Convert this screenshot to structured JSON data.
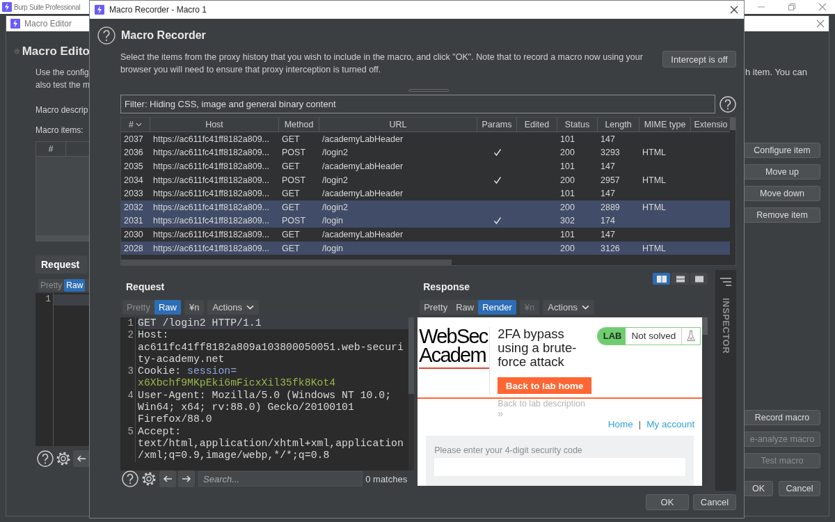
{
  "app_window": {
    "title": "Burp Suite Professional"
  },
  "macro_editor": {
    "title": "Macro Editor",
    "heading": "Macro Edito",
    "description_left": [
      "Use the config",
      "also test the m"
    ],
    "description_right": "h item. You can",
    "description_label": "Macro descrip",
    "items_label": "Macro items:",
    "items_columns": [
      "#"
    ],
    "request_tab": "Request",
    "view_tabs": [
      {
        "label": "Pretty",
        "selected": false
      },
      {
        "label": "Raw",
        "selected": true
      }
    ],
    "line_numbers": [
      "1"
    ],
    "side_buttons": [
      {
        "label": "Configure item",
        "disabled": false
      },
      {
        "label": "Move up",
        "disabled": false
      },
      {
        "label": "Move down",
        "disabled": false
      },
      {
        "label": "Remove item",
        "disabled": false
      }
    ],
    "macro_buttons": [
      {
        "label": "Record macro",
        "disabled": false
      },
      {
        "label": "e-analyze macro",
        "disabled": true
      },
      {
        "label": "Test macro",
        "disabled": true
      }
    ],
    "dialog_buttons": [
      "OK",
      "Cancel"
    ]
  },
  "macro_recorder": {
    "title": "Macro Recorder - Macro 1",
    "heading": "Macro Recorder",
    "description": "Select the items from the proxy history that you wish to include in the macro, and click \"OK\". Note that to record a macro now using your browser you will need to ensure that proxy interception is turned off.",
    "intercept_button": "Intercept is off",
    "filter": "Filter: Hiding CSS, image and general binary content",
    "table": {
      "columns": [
        "#",
        "Host",
        "Method",
        "URL",
        "Params",
        "Edited",
        "Status",
        "Length",
        "MIME type",
        "Extensio"
      ],
      "rows": [
        {
          "number": "2037",
          "host": "https://ac611fc41ff8182a809...",
          "method": "GET",
          "url": "/academyLabHeader",
          "params": false,
          "status": "101",
          "length": "147",
          "selected": false
        },
        {
          "number": "2036",
          "host": "https://ac611fc41ff8182a809...",
          "method": "POST",
          "url": "/login2",
          "params": true,
          "status": "200",
          "length": "3293",
          "mime": "HTML",
          "selected": false
        },
        {
          "number": "2035",
          "host": "https://ac611fc41ff8182a809...",
          "method": "GET",
          "url": "/academyLabHeader",
          "params": false,
          "status": "101",
          "length": "147",
          "selected": false
        },
        {
          "number": "2034",
          "host": "https://ac611fc41ff8182a809...",
          "method": "POST",
          "url": "/login2",
          "params": true,
          "status": "200",
          "length": "2957",
          "mime": "HTML",
          "selected": false
        },
        {
          "number": "2033",
          "host": "https://ac611fc41ff8182a809...",
          "method": "GET",
          "url": "/academyLabHeader",
          "params": false,
          "status": "101",
          "length": "147",
          "selected": false
        },
        {
          "number": "2032",
          "host": "https://ac611fc41ff8182a809...",
          "method": "GET",
          "url": "/login2",
          "params": false,
          "status": "200",
          "length": "2889",
          "mime": "HTML",
          "selected": true
        },
        {
          "number": "2031",
          "host": "https://ac611fc41ff8182a809...",
          "method": "POST",
          "url": "/login",
          "params": true,
          "status": "302",
          "length": "174",
          "selected": true
        },
        {
          "number": "2030",
          "host": "https://ac611fc41ff8182a809...",
          "method": "GET",
          "url": "/academyLabHeader",
          "params": false,
          "status": "101",
          "length": "147",
          "selected": false
        },
        {
          "number": "2028",
          "host": "https://ac611fc41ff8182a809...",
          "method": "GET",
          "url": "/login",
          "params": false,
          "status": "200",
          "length": "3126",
          "mime": "HTML",
          "selected": true
        }
      ]
    },
    "request": {
      "heading": "Request",
      "view_tabs": [
        {
          "label": "Pretty",
          "selected": false
        },
        {
          "label": "Raw",
          "selected": true
        }
      ],
      "newline_button": {
        "label": "¥n",
        "disabled": false
      },
      "actions": "Actions",
      "lines": [
        {
          "number": "1",
          "current": true,
          "rows": [
            [
              {
                "text": "GET /login2 HTTP/1.1",
                "kind": "plain"
              }
            ]
          ]
        },
        {
          "number": "2",
          "current": false,
          "rows": [
            [
              {
                "text": "Host:",
                "kind": "plain"
              }
            ],
            [
              {
                "text": "ac611fc41ff8182a809a103800050051.web-securi",
                "kind": "plain"
              }
            ],
            [
              {
                "text": "ty-academy.net",
                "kind": "plain"
              }
            ]
          ]
        },
        {
          "number": "3",
          "current": false,
          "rows": [
            [
              {
                "text": "Cookie: ",
                "kind": "plain"
              },
              {
                "text": "session=",
                "kind": "name"
              }
            ],
            [
              {
                "text": "x6Xbchf9MKpEki6mFicxXil35fk8Kot4",
                "kind": "value"
              }
            ]
          ]
        },
        {
          "number": "4",
          "current": false,
          "rows": [
            [
              {
                "text": "User-Agent: Mozilla/5.0 (Windows NT 10.0;",
                "kind": "plain"
              }
            ],
            [
              {
                "text": "Win64; x64; rv:88.0) Gecko/20100101",
                "kind": "plain"
              }
            ],
            [
              {
                "text": "Firefox/88.0",
                "kind": "plain"
              }
            ]
          ]
        },
        {
          "number": "5",
          "current": false,
          "rows": [
            [
              {
                "text": "Accept:",
                "kind": "plain"
              }
            ],
            [
              {
                "text": "text/html,application/xhtml+xml,application",
                "kind": "plain"
              }
            ],
            [
              {
                "text": "/xml;q=0.9,image/webp,*/*;q=0.8",
                "kind": "plain"
              }
            ]
          ]
        }
      ],
      "search_placeholder": "Search...",
      "matches": "0 matches"
    },
    "response": {
      "heading": "Response",
      "layout_modes": [
        {
          "kind": "side-by-side",
          "selected": true
        },
        {
          "kind": "stacked",
          "selected": false
        },
        {
          "kind": "single",
          "selected": false
        }
      ],
      "view_tabs": [
        {
          "label": "Pretty",
          "selected": false
        },
        {
          "label": "Raw",
          "selected": false
        },
        {
          "label": "Render",
          "selected": true
        }
      ],
      "newline_button": {
        "label": "¥n",
        "disabled": true
      },
      "actions": "Actions",
      "page": {
        "logo_lines": [
          "WebSec",
          "Academ"
        ],
        "title": "2FA bypass using a brute-force attack",
        "lab_badge": "LAB",
        "lab_status": "Not solved",
        "back_button": "Back to lab home",
        "back_link": "Back to lab description",
        "chevron": "»",
        "nav": [
          "Home",
          "My account"
        ],
        "nav_separator": "|",
        "form_label": "Please enter your 4-digit security code"
      }
    },
    "inspector": {
      "label": "INSPECTOR"
    },
    "dialog_buttons": [
      "OK",
      "Cancel"
    ]
  }
}
